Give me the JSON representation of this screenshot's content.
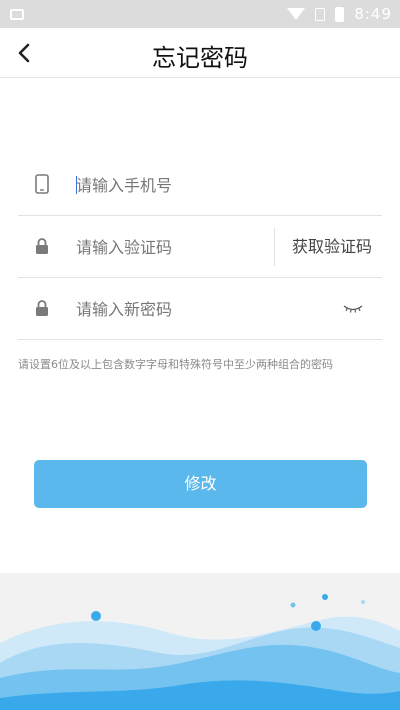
{
  "status_bar": {
    "time": "8:49"
  },
  "header": {
    "title": "忘记密码"
  },
  "form": {
    "phone_placeholder": "请输入手机号",
    "code_placeholder": "请输入验证码",
    "get_code_label": "获取验证码",
    "password_placeholder": "请输入新密码"
  },
  "hint": "请设置6位及以上包含数字字母和特殊符号中至少两种组合的密码",
  "submit_label": "修改",
  "colors": {
    "accent": "#5bb8ec",
    "wave_light": "#a9d8f5",
    "wave_dark": "#3aa9ec"
  }
}
